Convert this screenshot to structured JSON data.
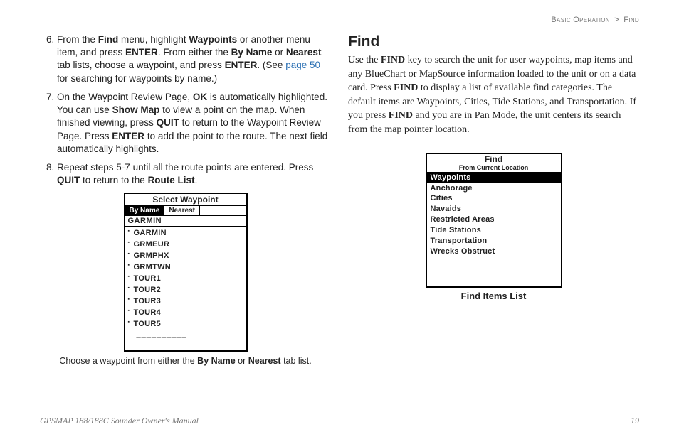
{
  "breadcrumb": {
    "part1": "Basic Operation",
    "sep": ">",
    "part2": "Find"
  },
  "left": {
    "start": 6,
    "items": [
      {
        "segs": [
          {
            "t": "From the "
          },
          {
            "t": "Find",
            "b": true
          },
          {
            "t": " menu, highlight "
          },
          {
            "t": "Waypoints",
            "b": true
          },
          {
            "t": " or another menu item, and press "
          },
          {
            "t": "ENTER",
            "b": true
          },
          {
            "t": ". From either the "
          },
          {
            "t": "By Name",
            "b": true
          },
          {
            "t": " or "
          },
          {
            "t": "Nearest",
            "b": true
          },
          {
            "t": " tab lists, choose a waypoint, and press "
          },
          {
            "t": "ENTER",
            "b": true
          },
          {
            "t": ". (See "
          },
          {
            "t": "page 50",
            "link": true
          },
          {
            "t": " for searching for waypoints by name.)"
          }
        ]
      },
      {
        "segs": [
          {
            "t": "On the Waypoint Review Page, "
          },
          {
            "t": "OK",
            "b": true
          },
          {
            "t": " is automatically highlighted. You can use "
          },
          {
            "t": "Show Map",
            "b": true
          },
          {
            "t": " to view a point on the map. When finished viewing, press "
          },
          {
            "t": "QUIT",
            "b": true
          },
          {
            "t": " to return to the Waypoint Review Page. Press "
          },
          {
            "t": "ENTER",
            "b": true
          },
          {
            "t": " to add the point to the route. The next field automatically highlights."
          }
        ]
      },
      {
        "segs": [
          {
            "t": "Repeat steps 5-7 until all the route points are entered. Press "
          },
          {
            "t": "QUIT",
            "b": true
          },
          {
            "t": " to return to the "
          },
          {
            "t": "Route List",
            "b": true
          },
          {
            "t": "."
          }
        ]
      }
    ],
    "figure": {
      "title": "Select Waypoint",
      "tabs": [
        "By Name",
        "Nearest"
      ],
      "active_tab": 0,
      "input": "GARMIN",
      "waypoints": [
        "GARMIN",
        "GRMEUR",
        "GRMPHX",
        "GRMTWN",
        "TOUR1",
        "TOUR2",
        "TOUR3",
        "TOUR4",
        "TOUR5"
      ],
      "dash_rows": [
        "__________",
        "__________"
      ],
      "caption": [
        {
          "t": "Choose a waypoint from either the "
        },
        {
          "t": "By Name",
          "b": true
        },
        {
          "t": " or "
        },
        {
          "t": "Nearest",
          "b": true
        },
        {
          "t": " tab list."
        }
      ]
    }
  },
  "right": {
    "heading": "Find",
    "para": [
      {
        "t": "Use the "
      },
      {
        "t": "FIND",
        "b": true
      },
      {
        "t": " key to search the unit for user waypoints, map items and any BlueChart or MapSource information loaded to the unit or on a data card. Press "
      },
      {
        "t": "FIND",
        "b": true
      },
      {
        "t": " to display a list of available find categories. The default items are Waypoints, Cities, Tide Stations, and Transportation. If you press "
      },
      {
        "t": "FIND",
        "b": true
      },
      {
        "t": " and you are in Pan Mode, the unit centers its search from the map pointer location."
      }
    ],
    "figure": {
      "title": "Find",
      "subtitle": "From Current Location",
      "cats": [
        "Waypoints",
        "Anchorage",
        "Cities",
        "Navaids",
        "Restricted Areas",
        "Tide Stations",
        "Transportation",
        "Wrecks Obstruct"
      ],
      "selected": 0,
      "caption": "Find Items List"
    }
  },
  "footer": {
    "manual": "GPSMAP 188/188C Sounder Owner's Manual",
    "page": "19"
  }
}
